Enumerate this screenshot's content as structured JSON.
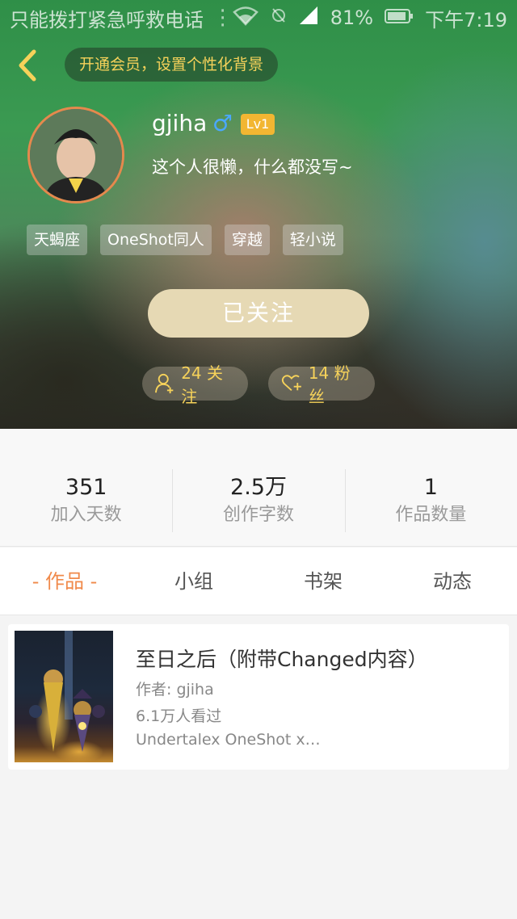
{
  "status_bar": {
    "carrier": "只能拨打紧急呼救电话",
    "battery": "81%",
    "time": "下午7:19"
  },
  "header": {
    "vip_prompt": "开通会员，设置个性化背景",
    "username": "gjiha",
    "gender_symbol": "♂",
    "level": "Lv1",
    "bio": "这个人很懒，什么都没写~",
    "tags": [
      "天蝎座",
      "OneShot同人",
      "穿越",
      "轻小说"
    ],
    "follow_button": "已关注",
    "following_count": "24 关注",
    "fans_count": "14 粉丝",
    "accent_color": "#f6d25a"
  },
  "stats": [
    {
      "value": "351",
      "label": "加入天数"
    },
    {
      "value": "2.5万",
      "label": "创作字数"
    },
    {
      "value": "1",
      "label": "作品数量"
    }
  ],
  "tabs": [
    {
      "label": "- 作品 -",
      "active": true
    },
    {
      "label": "小组",
      "active": false
    },
    {
      "label": "书架",
      "active": false
    },
    {
      "label": "动态",
      "active": false
    }
  ],
  "works": [
    {
      "title": "至日之后（附带Changed内容）",
      "author": "作者: gjiha",
      "views": "6.1万人看过",
      "description": "Undertalex OneShot x…"
    }
  ]
}
